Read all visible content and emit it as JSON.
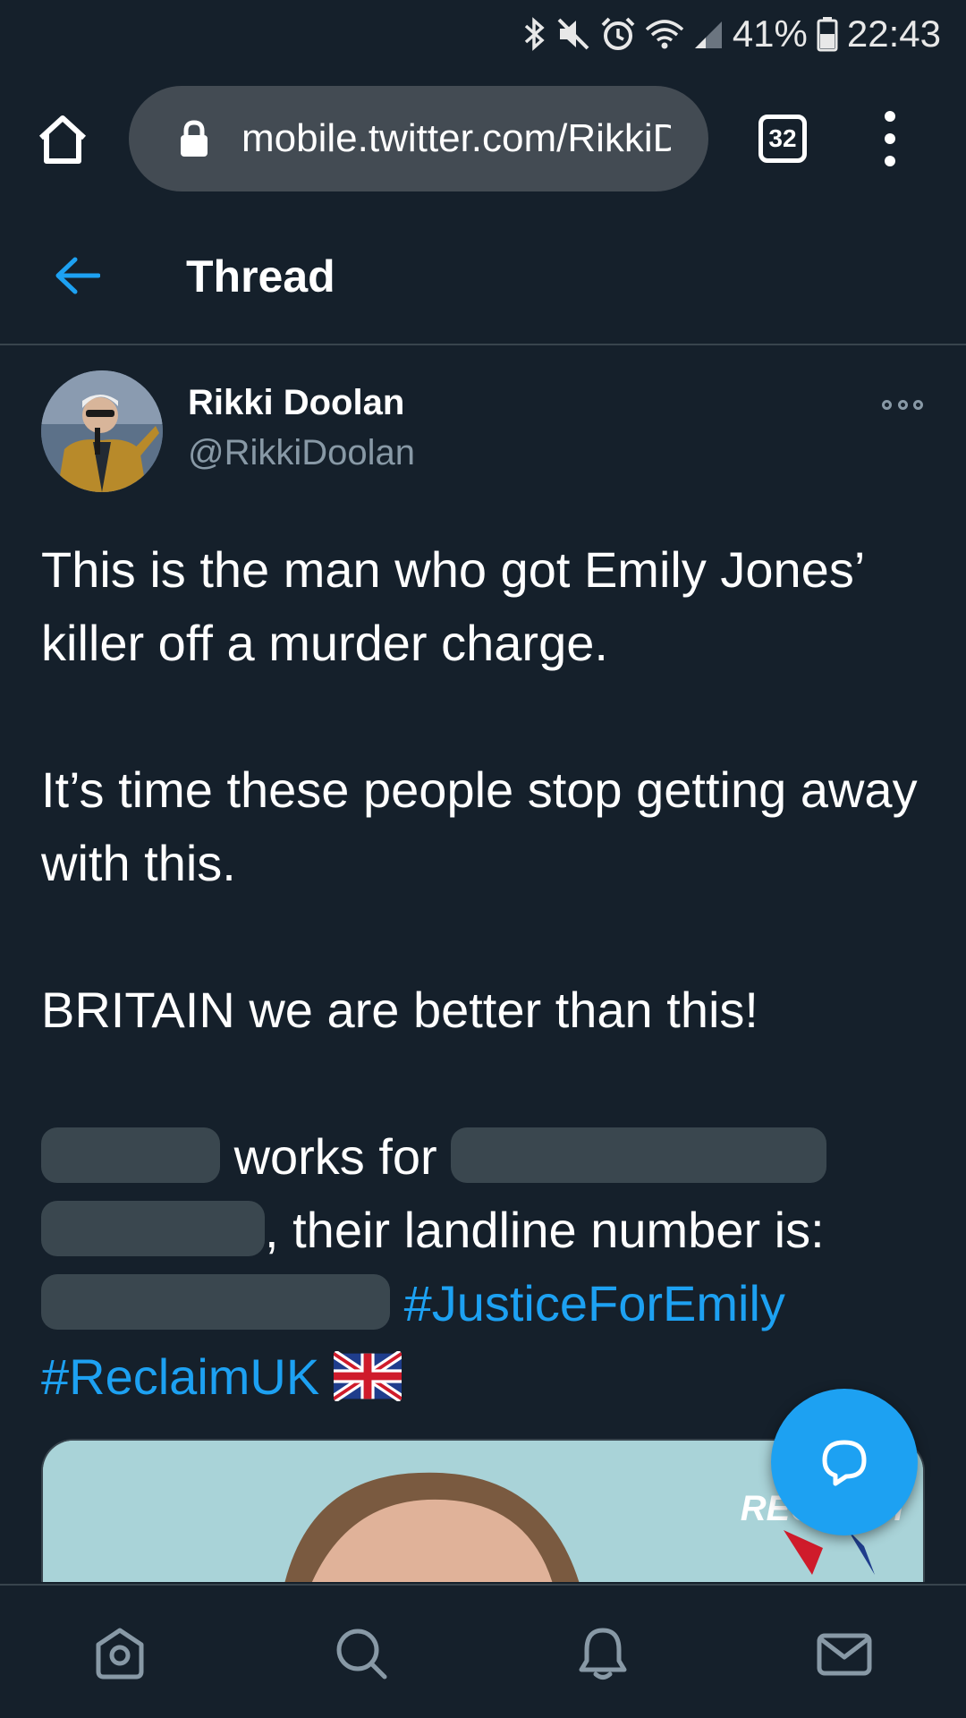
{
  "status_bar": {
    "battery": "41%",
    "time": "22:43",
    "icons": [
      "bluetooth-icon",
      "mute-icon",
      "alarm-icon",
      "wifi-icon",
      "signal-icon",
      "battery-icon"
    ]
  },
  "browser": {
    "url": "mobile.twitter.com/RikkiDoolan",
    "tab_count": "32",
    "icons": [
      "home-icon",
      "lock-icon",
      "tabs-icon",
      "menu-icon"
    ]
  },
  "header": {
    "title": "Thread",
    "back_icon": "back-arrow-icon"
  },
  "tweet": {
    "author_name": "Rikki Doolan",
    "author_handle": "@RikkiDoolan",
    "paragraph_1": "This is the man who got Emily Jones’ killer off a murder charge.",
    "paragraph_2": "It’s time these people stop getting away with this.",
    "paragraph_3": "BRITAIN we are better than this!",
    "paragraph_4_part_1": "works for",
    "paragraph_4_part_2": ", their landline number is:",
    "hashtag_1": "#JusticeForEmily",
    "hashtag_2": "#ReclaimUK",
    "emoji": "flag-uk-icon",
    "media_logo": "RECLAIM"
  },
  "fab": {
    "icon": "compose-reply-icon"
  },
  "bottom_nav": {
    "items": [
      "home-icon",
      "search-icon",
      "notifications-icon",
      "messages-icon"
    ]
  },
  "colors": {
    "background": "#15202b",
    "accent": "#1da1f2",
    "secondary_text": "#8899a6",
    "divider": "#38444d"
  }
}
